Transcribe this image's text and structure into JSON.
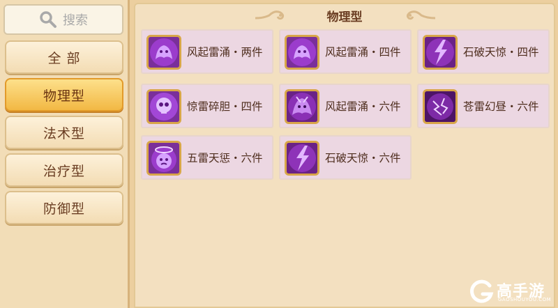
{
  "search": {
    "placeholder": "搜索",
    "icon": "search-icon"
  },
  "categories": [
    {
      "label": "全 部",
      "active": false
    },
    {
      "label": "物理型",
      "active": true
    },
    {
      "label": "法术型",
      "active": false
    },
    {
      "label": "治疗型",
      "active": false
    },
    {
      "label": "防御型",
      "active": false
    }
  ],
  "panel": {
    "title": "物理型"
  },
  "items": [
    {
      "name": "风起雷涌・两件",
      "icon": "purple-spirit-icon"
    },
    {
      "name": "风起雷涌・四件",
      "icon": "purple-spirit-icon"
    },
    {
      "name": "石破天惊・四件",
      "icon": "purple-lightning-icon"
    },
    {
      "name": "惊雷碎胆・四件",
      "icon": "purple-skull-icon"
    },
    {
      "name": "风起雷涌・六件",
      "icon": "purple-spirit-icon"
    },
    {
      "name": "苍雷幻昼・六件",
      "icon": "purple-orb-lightning-icon"
    },
    {
      "name": "五雷天惩・六件",
      "icon": "purple-dizzy-icon"
    },
    {
      "name": "石破天惊・六件",
      "icon": "purple-lightning-icon"
    }
  ],
  "watermark": {
    "brand": "高手游",
    "domain": "GAOSHOUYOU.COM"
  },
  "colors": {
    "active_tab": "#f2b844",
    "card_bg": "#ecd7e2",
    "panel_bg": "#f3e0c0",
    "text_brown": "#6a3d22"
  }
}
